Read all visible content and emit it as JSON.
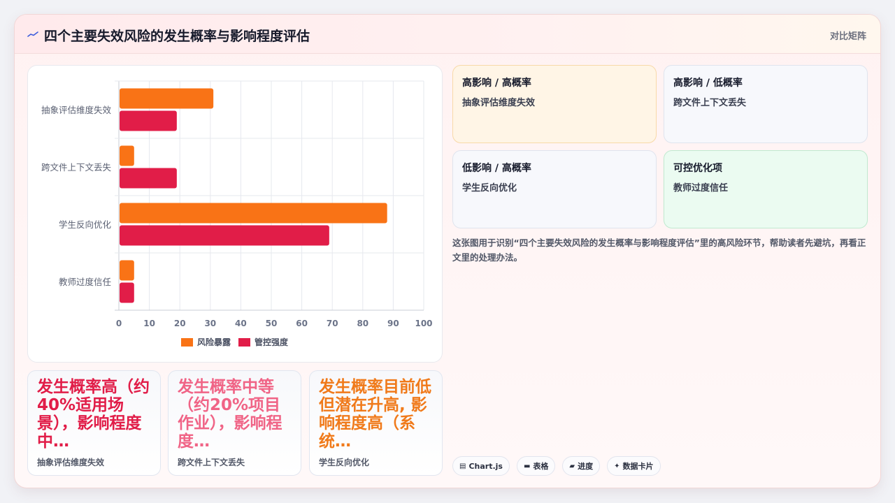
{
  "header": {
    "title": "四个主要失效风险的发生概率与影响程度评估",
    "link": "对比矩阵",
    "icon": "trend-line-icon"
  },
  "colors": {
    "exposure": "#f97316",
    "control": "#e11d48",
    "kpi_1": "#e11d48",
    "kpi_2": "#f06486",
    "kpi_3": "#f07a1a"
  },
  "chart_data": {
    "type": "bar",
    "orientation": "horizontal",
    "categories": [
      "抽象评估维度失效",
      "跨文件上下文丢失",
      "学生反向优化",
      "教师过度信任"
    ],
    "series": [
      {
        "name": "风险暴露",
        "values": [
          31,
          5,
          88,
          5
        ]
      },
      {
        "name": "管控强度",
        "values": [
          19,
          19,
          69,
          5
        ]
      }
    ],
    "xlim": [
      0,
      100
    ],
    "xticks": [
      "0",
      "10",
      "20",
      "30",
      "40",
      "50",
      "60",
      "70",
      "80",
      "90",
      "100"
    ],
    "grid": true,
    "legend": "bottom"
  },
  "kpis": [
    {
      "value": "发生概率高（约40%适用场景），影响程度中…",
      "label": "抽象评估维度失效"
    },
    {
      "value": "发生概率中等（约20%项目作业），影响程度…",
      "label": "跨文件上下文丢失"
    },
    {
      "value": "发生概率目前低但潜在升高, 影响程度高（系统…",
      "label": "学生反向优化"
    }
  ],
  "quadrants": [
    {
      "title": "高影响 / 高概率",
      "item": "抽象评估维度失效"
    },
    {
      "title": "高影响 / 低概率",
      "item": "跨文件上下文丢失"
    },
    {
      "title": "低影响 / 高概率",
      "item": "学生反向优化"
    },
    {
      "title": "可控优化项",
      "item": "教师过度信任"
    }
  ],
  "note": "这张图用于识别“四个主要失效风险的发生概率与影响程度评估”里的高风险环节，帮助读者先避坑，再看正文里的处理办法。",
  "chips": [
    {
      "icon": "chart-icon",
      "glyph": "▤",
      "label": "Chart.js"
    },
    {
      "icon": "table-icon",
      "glyph": "▬",
      "label": "表格"
    },
    {
      "icon": "progress-icon",
      "glyph": "▰",
      "label": "进度"
    },
    {
      "icon": "sparkle-icon",
      "glyph": "✦",
      "label": "数据卡片"
    }
  ]
}
